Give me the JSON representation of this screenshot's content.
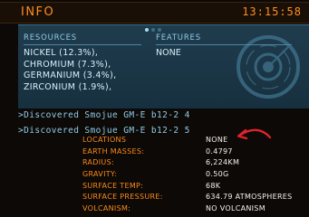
{
  "header": {
    "title": "INFO",
    "time": "13:15:58"
  },
  "panel": {
    "page_indicator": {
      "count": 3,
      "active_index": 0
    },
    "resources": {
      "title": "RESOURCES",
      "items": [
        "NICKEL (12.3%),",
        "CHROMIUM (7.3%),",
        "GERMANIUM (3.4%),",
        "ZIRCONIUM (1.9%),"
      ]
    },
    "features": {
      "title": "FEATURES",
      "value": "NONE"
    }
  },
  "log": [
    ">Discovered Smojue GM-E b12-2 4",
    ">Discovered Smojue GM-E b12-2 5"
  ],
  "stats": [
    {
      "label": "LOCATIONS",
      "value": "NONE"
    },
    {
      "label": "EARTH MASSES:",
      "value": "0.4797"
    },
    {
      "label": "RADIUS:",
      "value": "6,224KM"
    },
    {
      "label": "GRAVITY:",
      "value": "0.50G"
    },
    {
      "label": "SURFACE TEMP:",
      "value": "68K"
    },
    {
      "label": "SURFACE PRESSURE:",
      "value": "634.79 ATMOSPHERES"
    },
    {
      "label": "VOLCANISM:",
      "value": "NO VOLCANISM"
    }
  ],
  "colors": {
    "accent_orange": "#ff8a1a",
    "panel_blue": "#1f3c4d",
    "text_light_blue": "#8fcbe8",
    "annotation_red": "#e0222a"
  },
  "icons": {
    "radar": "radar-icon",
    "annotation": "red-arrow-annotation"
  }
}
